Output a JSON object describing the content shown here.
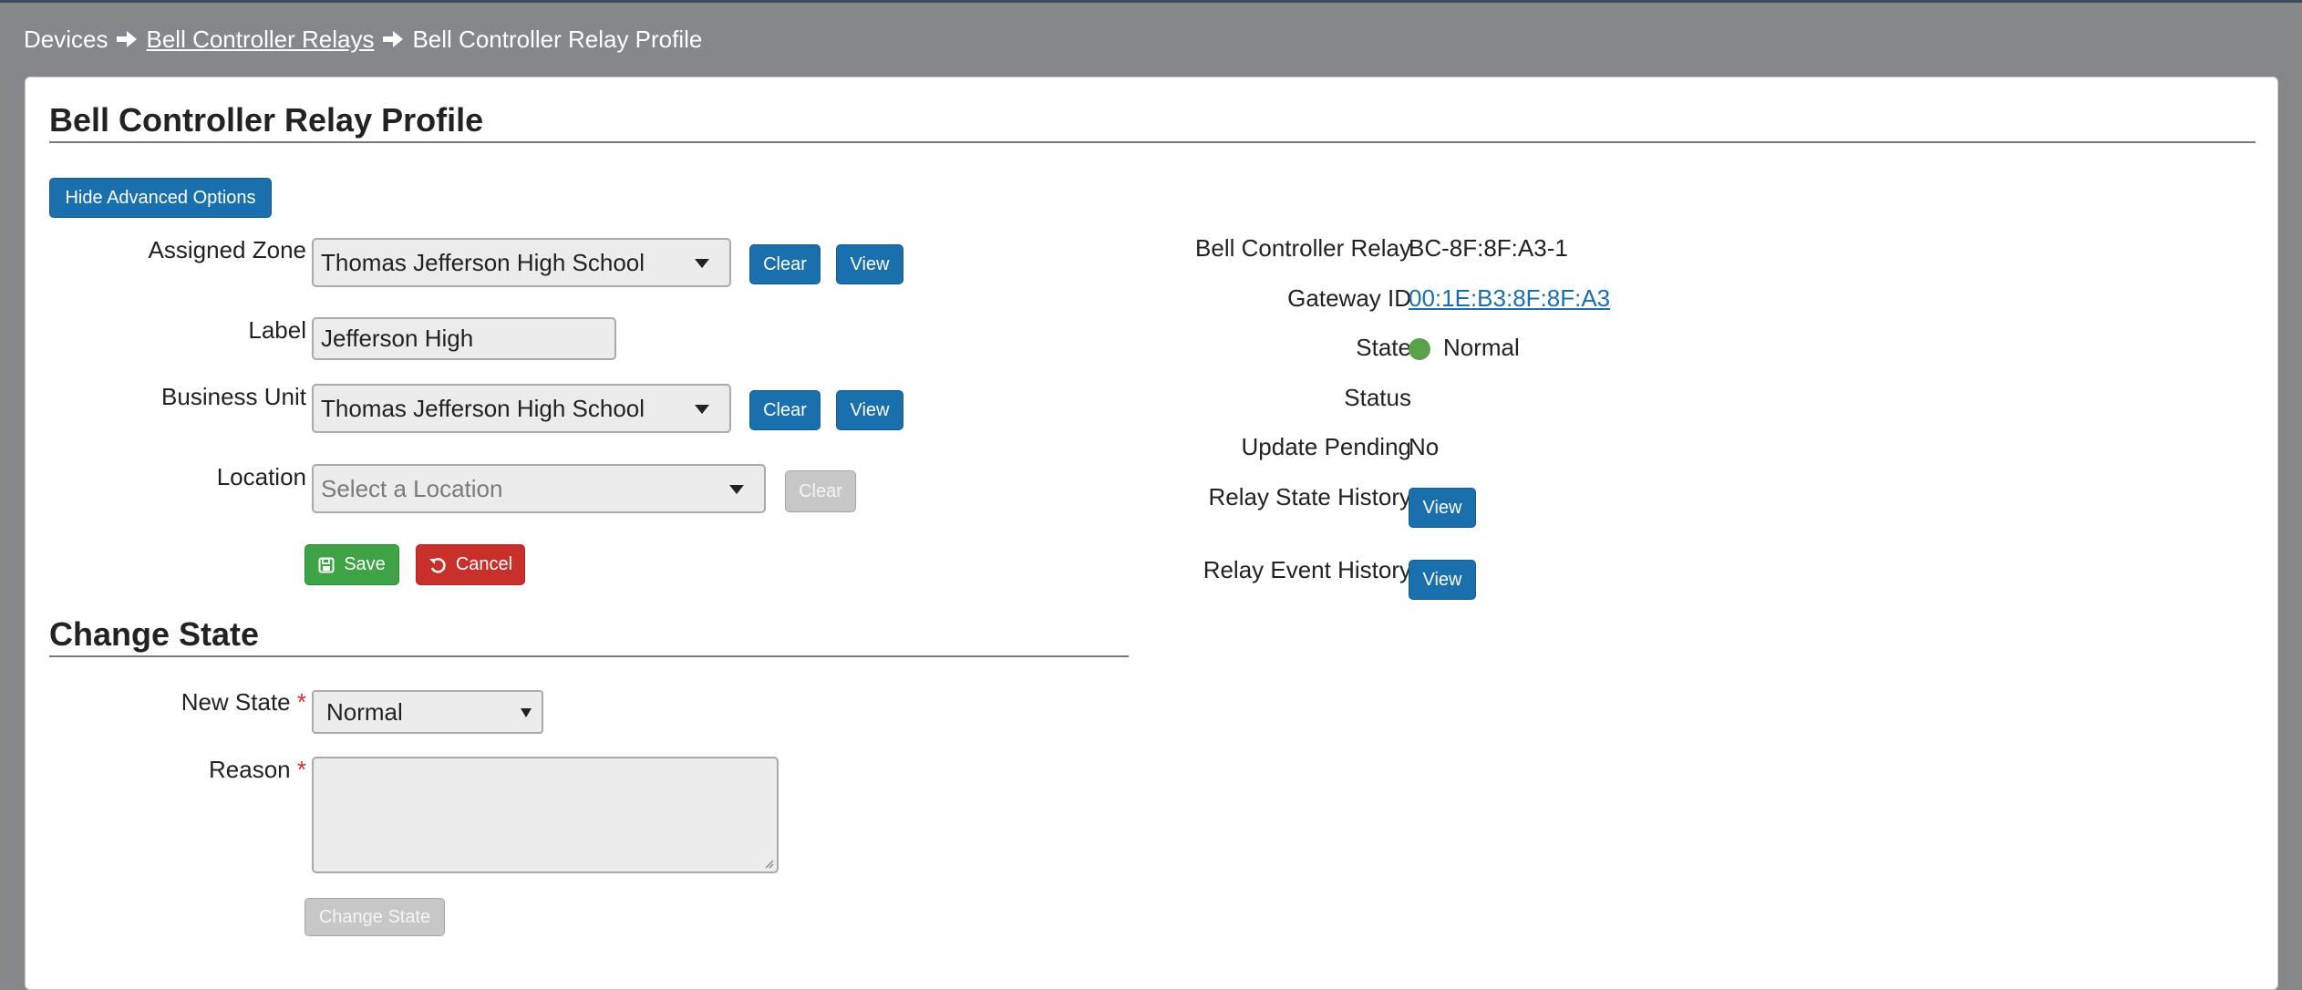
{
  "breadcrumb": {
    "root": "Devices",
    "parent": "Bell Controller Relays",
    "current": "Bell Controller Relay Profile"
  },
  "page": {
    "title": "Bell Controller Relay Profile",
    "toggle_advanced_label": "Hide Advanced Options"
  },
  "form": {
    "assigned_zone": {
      "label": "Assigned Zone",
      "value": "Thomas Jefferson High School",
      "clear": "Clear",
      "view": "View"
    },
    "label": {
      "label": "Label",
      "value": "Jefferson High"
    },
    "business_unit": {
      "label": "Business Unit",
      "value": "Thomas Jefferson High School",
      "clear": "Clear",
      "view": "View"
    },
    "location": {
      "label": "Location",
      "placeholder": "Select a Location",
      "clear": "Clear"
    },
    "save": "Save",
    "cancel": "Cancel"
  },
  "details": {
    "relay": {
      "label": "Bell Controller Relay",
      "value": "BC-8F:8F:A3-1"
    },
    "gateway": {
      "label": "Gateway ID",
      "value": "00:1E:B3:8F:8F:A3"
    },
    "state": {
      "label": "State",
      "value": "Normal",
      "color": "#5aa24a"
    },
    "status": {
      "label": "Status",
      "value": ""
    },
    "update_pending": {
      "label": "Update Pending",
      "value": "No"
    },
    "relay_state_history": {
      "label": "Relay State History",
      "button": "View"
    },
    "relay_event_history": {
      "label": "Relay Event History",
      "button": "View"
    }
  },
  "change_state": {
    "title": "Change State",
    "new_state": {
      "label": "New State",
      "required": "*",
      "value": "Normal"
    },
    "reason": {
      "label": "Reason",
      "required": "*",
      "value": ""
    },
    "submit": "Change State"
  },
  "colors": {
    "primary": "#1a6fad",
    "success": "#3ea344",
    "danger": "#c9302c",
    "background": "#85878a"
  }
}
